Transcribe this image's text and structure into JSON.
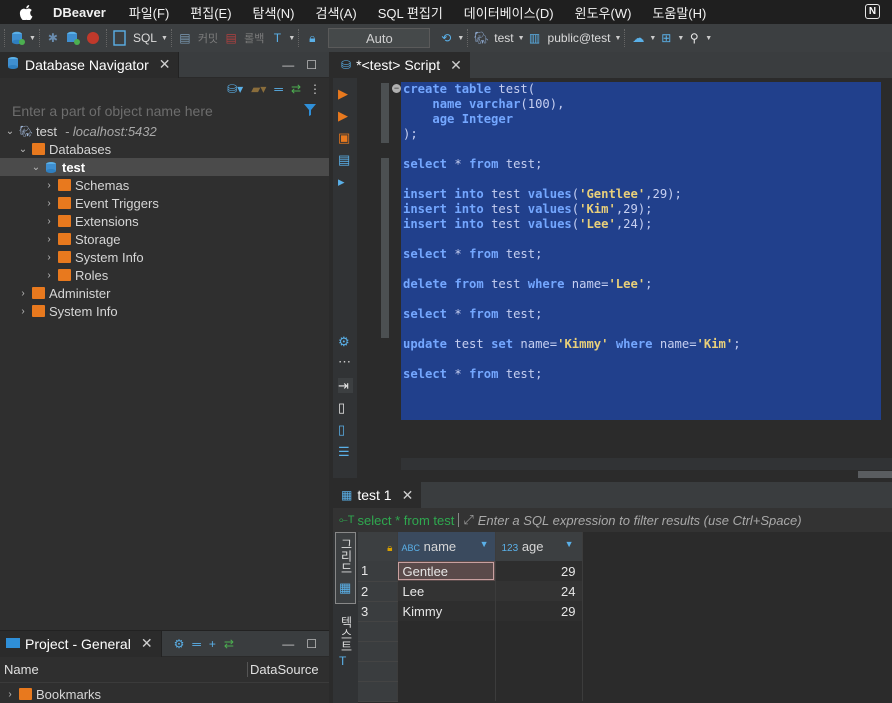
{
  "menu": {
    "app": "DBeaver",
    "items": [
      "파일(F)",
      "편집(E)",
      "탐색(N)",
      "검색(A)",
      "SQL 편집기",
      "데이터베이스(D)",
      "윈도우(W)",
      "도움말(H)"
    ],
    "badge": "N"
  },
  "toolbar": {
    "sql": "SQL",
    "commit": "커밋",
    "rollback": "롤백",
    "tx_mode": "Auto",
    "db": "test",
    "schema": "public@test"
  },
  "navigator": {
    "title": "Database Navigator",
    "filter_placeholder": "Enter a part of object name here",
    "conn_name": "test",
    "conn_host": "- localhost:5432",
    "items": [
      {
        "label": "Databases"
      },
      {
        "label": "test"
      },
      {
        "label": "Schemas"
      },
      {
        "label": "Event Triggers"
      },
      {
        "label": "Extensions"
      },
      {
        "label": "Storage"
      },
      {
        "label": "System Info"
      },
      {
        "label": "Roles"
      },
      {
        "label": "Administer"
      },
      {
        "label": "System Info"
      }
    ]
  },
  "project": {
    "title": "Project - General",
    "col_name": "Name",
    "col_ds": "DataSource",
    "bookmarks": "Bookmarks"
  },
  "editor": {
    "tab": "*<test> Script",
    "lines": [
      [
        [
          "kw",
          "create table "
        ],
        [
          "id",
          "test("
        ]
      ],
      [
        [
          "id",
          "    "
        ],
        [
          "kw",
          "name varchar"
        ],
        [
          "id",
          "(100),"
        ]
      ],
      [
        [
          "id",
          "    "
        ],
        [
          "kw",
          "age Integer"
        ]
      ],
      [
        [
          "id",
          ");"
        ]
      ],
      [],
      [
        [
          "kw",
          "select "
        ],
        [
          "id",
          "* "
        ],
        [
          "kw",
          "from "
        ],
        [
          "id",
          "test;"
        ]
      ],
      [],
      [
        [
          "kw",
          "insert into "
        ],
        [
          "id",
          "test "
        ],
        [
          "kw",
          "values"
        ],
        [
          "id",
          "("
        ],
        [
          "str",
          "'Gentlee'"
        ],
        [
          "id",
          ",29);"
        ]
      ],
      [
        [
          "kw",
          "insert into "
        ],
        [
          "id",
          "test "
        ],
        [
          "kw",
          "values"
        ],
        [
          "id",
          "("
        ],
        [
          "str",
          "'Kim'"
        ],
        [
          "id",
          ",29);"
        ]
      ],
      [
        [
          "kw",
          "insert into "
        ],
        [
          "id",
          "test "
        ],
        [
          "kw",
          "values"
        ],
        [
          "id",
          "("
        ],
        [
          "str",
          "'Lee'"
        ],
        [
          "id",
          ",24);"
        ]
      ],
      [],
      [
        [
          "kw",
          "select "
        ],
        [
          "id",
          "* "
        ],
        [
          "kw",
          "from "
        ],
        [
          "id",
          "test;"
        ]
      ],
      [],
      [
        [
          "kw",
          "delete from "
        ],
        [
          "id",
          "test "
        ],
        [
          "kw",
          "where "
        ],
        [
          "id",
          "name="
        ],
        [
          "str",
          "'Lee'"
        ],
        [
          "id",
          ";"
        ]
      ],
      [],
      [
        [
          "kw",
          "select "
        ],
        [
          "id",
          "* "
        ],
        [
          "kw",
          "from "
        ],
        [
          "id",
          "test;"
        ]
      ],
      [],
      [
        [
          "kw",
          "update "
        ],
        [
          "id",
          "test "
        ],
        [
          "kw",
          "set "
        ],
        [
          "id",
          "name="
        ],
        [
          "str",
          "'Kimmy'"
        ],
        [
          "id",
          " "
        ],
        [
          "kw",
          "where "
        ],
        [
          "id",
          "name="
        ],
        [
          "str",
          "'Kim'"
        ],
        [
          "id",
          ";"
        ]
      ],
      [],
      [
        [
          "kw",
          "select "
        ],
        [
          "id",
          "* "
        ],
        [
          "kw",
          "from "
        ],
        [
          "id",
          "test;"
        ]
      ]
    ]
  },
  "results": {
    "tab": "test 1",
    "query": "select * from test",
    "filter_placeholder": "Enter a SQL expression to filter results (use Ctrl+Space)",
    "grid_label": "그리드",
    "text_label": "텍스트",
    "columns": [
      {
        "type": "ABC",
        "name": "name"
      },
      {
        "type": "123",
        "name": "age"
      }
    ],
    "rows": [
      [
        "1",
        "Gentlee",
        "29"
      ],
      [
        "2",
        "Lee",
        "24"
      ],
      [
        "3",
        "Kimmy",
        "29"
      ]
    ]
  },
  "colors": {
    "accent": "#2f8fd8",
    "selection": "#21408c",
    "keyword": "#74a7ff",
    "string": "#e8cf7a"
  }
}
